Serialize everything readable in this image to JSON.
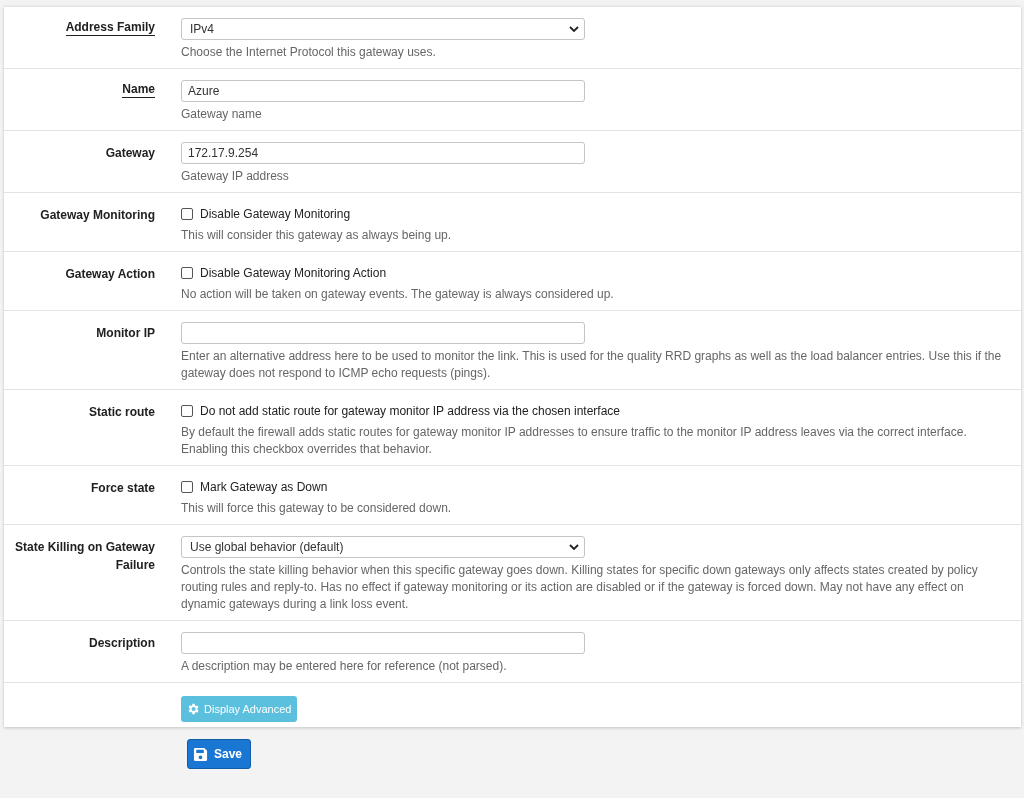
{
  "rows": [
    {
      "label": "Address Family",
      "required": true,
      "kind": "select",
      "value": "IPv4",
      "help": "Choose the Internet Protocol this gateway uses."
    },
    {
      "label": "Name",
      "required": true,
      "kind": "text",
      "value": "Azure",
      "help": "Gateway name"
    },
    {
      "label": "Gateway",
      "required": false,
      "kind": "text",
      "value": "172.17.9.254",
      "help": "Gateway IP address"
    },
    {
      "label": "Gateway Monitoring",
      "required": false,
      "kind": "checkbox",
      "checked": false,
      "option": "Disable Gateway Monitoring",
      "help": "This will consider this gateway as always being up."
    },
    {
      "label": "Gateway Action",
      "required": false,
      "kind": "checkbox",
      "checked": false,
      "option": "Disable Gateway Monitoring Action",
      "help": "No action will be taken on gateway events. The gateway is always considered up."
    },
    {
      "label": "Monitor IP",
      "required": false,
      "kind": "text",
      "help": "Enter an alternative address here to be used to monitor the link. This is used for the quality RRD graphs as well as the load balancer entries. Use this if the gateway does not respond to ICMP echo requests (pings)."
    },
    {
      "label": "Static route",
      "required": false,
      "kind": "checkbox",
      "checked": false,
      "option": "Do not add static route for gateway monitor IP address via the chosen interface",
      "help": "By default the firewall adds static routes for gateway monitor IP addresses to ensure traffic to the monitor IP address leaves via the correct interface. Enabling this checkbox overrides that behavior."
    },
    {
      "label": "Force state",
      "required": false,
      "kind": "checkbox",
      "checked": false,
      "option": "Mark Gateway as Down",
      "help": "This will force this gateway to be considered down."
    },
    {
      "label": "State Killing on Gateway Failure",
      "required": false,
      "kind": "select",
      "value": "Use global behavior (default)",
      "help": "Controls the state killing behavior when this specific gateway goes down. Killing states for specific down gateways only affects states created by policy routing rules and reply-to. Has no effect if gateway monitoring or its action are disabled or if the gateway is forced down. May not have any effect on dynamic gateways during a link loss event."
    },
    {
      "label": "Description",
      "required": false,
      "kind": "text",
      "help": "A description may be entered here for reference (not parsed)."
    }
  ],
  "advanced_button": "Display Advanced",
  "save_button": "Save"
}
